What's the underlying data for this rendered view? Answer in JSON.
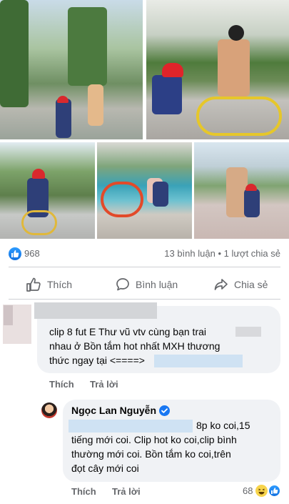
{
  "post": {
    "photos": [
      "photo-kids-cycling-path",
      "photo-mother-child-cycling",
      "photo-boy-bicycle-road",
      "photo-kids-by-pool",
      "photo-mother-child-walking"
    ],
    "reaction_count": "968",
    "comments_count": "13 bình luận",
    "shares_count": "1 lượt chia sẻ",
    "actions": {
      "like": "Thích",
      "comment": "Bình luận",
      "share": "Chia sẻ"
    }
  },
  "comments": [
    {
      "author": "",
      "text_lines": [
        "clip 8 fut E Thư vũ vtv cùng bạn trai",
        "nhau ở Bồn tắm hot nhất  MXH thương",
        "thức ngay tại <====>"
      ],
      "like_label": "Thích",
      "reply_label": "Trả lời"
    },
    {
      "author": "Ngọc Lan Nguyễn",
      "verified": true,
      "text_lines": [
        "8p ko coi,15",
        "tiếng mới coi. Clip hot ko coi,clip bình",
        "thường mới coi. Bồn tắm ko coi,trên",
        "đọt cây mới coi"
      ],
      "like_label": "Thích",
      "reply_label": "Trả lời",
      "reaction_count": "68"
    }
  ],
  "colors": {
    "accent": "#1877f2",
    "bubble": "#f0f2f5",
    "secondary_text": "#65676b"
  }
}
